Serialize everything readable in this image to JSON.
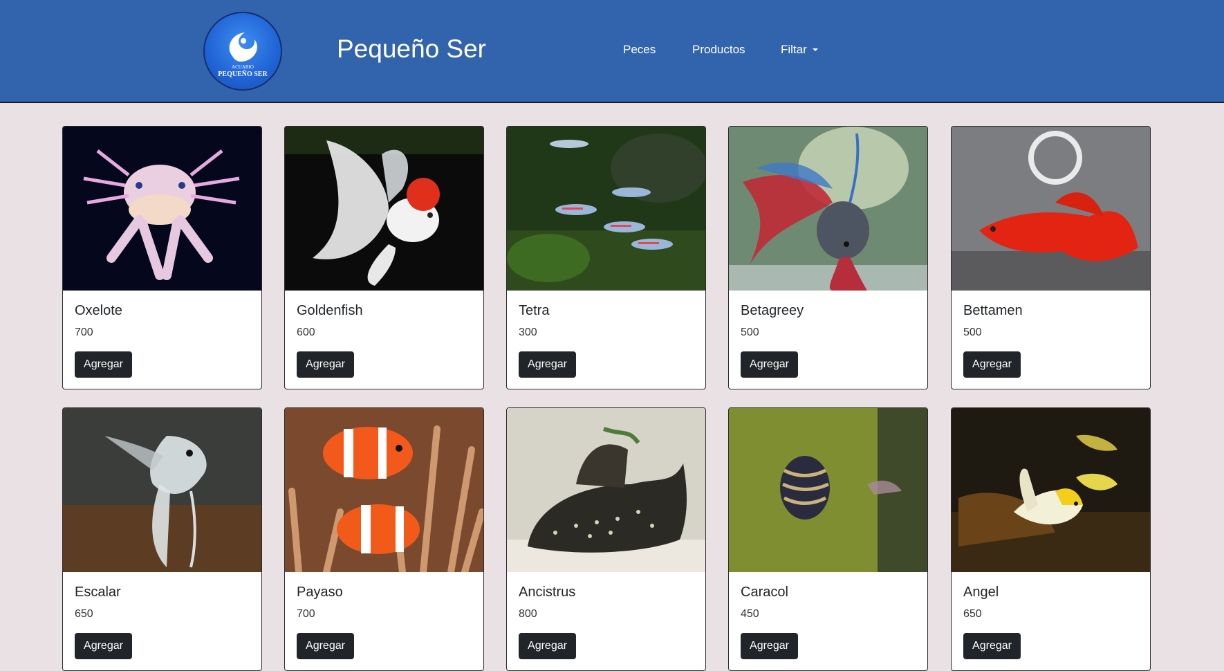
{
  "brand": {
    "name": "Pequeño Ser",
    "logo_text": "PEQUEÑO SER",
    "logo_subtext": "ACUARIO"
  },
  "nav": {
    "peces": "Peces",
    "productos": "Productos",
    "filtar": "Filtar"
  },
  "colors": {
    "navbar": "#3263ad",
    "page_background": "#e9e1e4",
    "button": "#212529"
  },
  "products": [
    {
      "name": "Oxelote",
      "price": "700",
      "button": "Agregar"
    },
    {
      "name": "Goldenfish",
      "price": "600",
      "button": "Agregar"
    },
    {
      "name": "Tetra",
      "price": "300",
      "button": "Agregar"
    },
    {
      "name": "Betagreey",
      "price": "500",
      "button": "Agregar"
    },
    {
      "name": "Bettamen",
      "price": "500",
      "button": "Agregar"
    },
    {
      "name": "Escalar",
      "price": "650",
      "button": "Agregar"
    },
    {
      "name": "Payaso",
      "price": "700",
      "button": "Agregar"
    },
    {
      "name": "Ancistrus",
      "price": "800",
      "button": "Agregar"
    },
    {
      "name": "Caracol",
      "price": "450",
      "button": "Agregar"
    },
    {
      "name": "Angel",
      "price": "650",
      "button": "Agregar"
    }
  ]
}
